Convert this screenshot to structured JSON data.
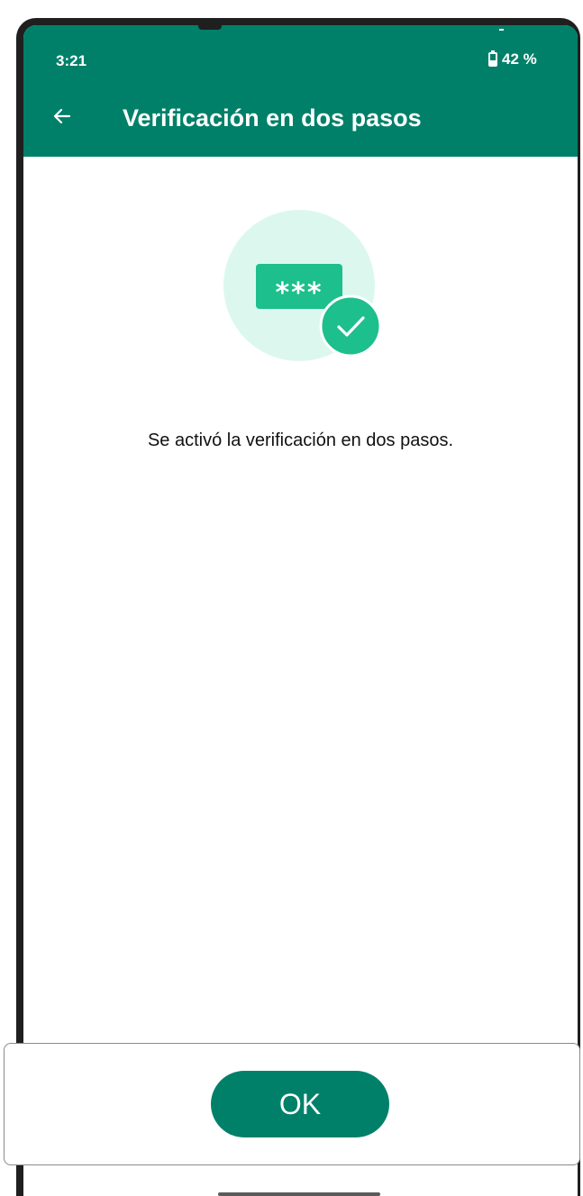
{
  "status_bar": {
    "time": "3:21",
    "battery": "42 %"
  },
  "app_bar": {
    "title": "Verificación en dos pasos",
    "back_icon": "arrow-left-icon"
  },
  "illustration": {
    "password_mask": "***",
    "icons": [
      "password-field-icon",
      "checkmark-badge-icon"
    ]
  },
  "message": "Se activó la verificación en dos pasos.",
  "footer": {
    "ok_label": "OK"
  },
  "colors": {
    "brand": "#008069",
    "accent": "#25D366",
    "illustration_bg": "#DCF8EE",
    "badge": "#1DBF8C"
  }
}
